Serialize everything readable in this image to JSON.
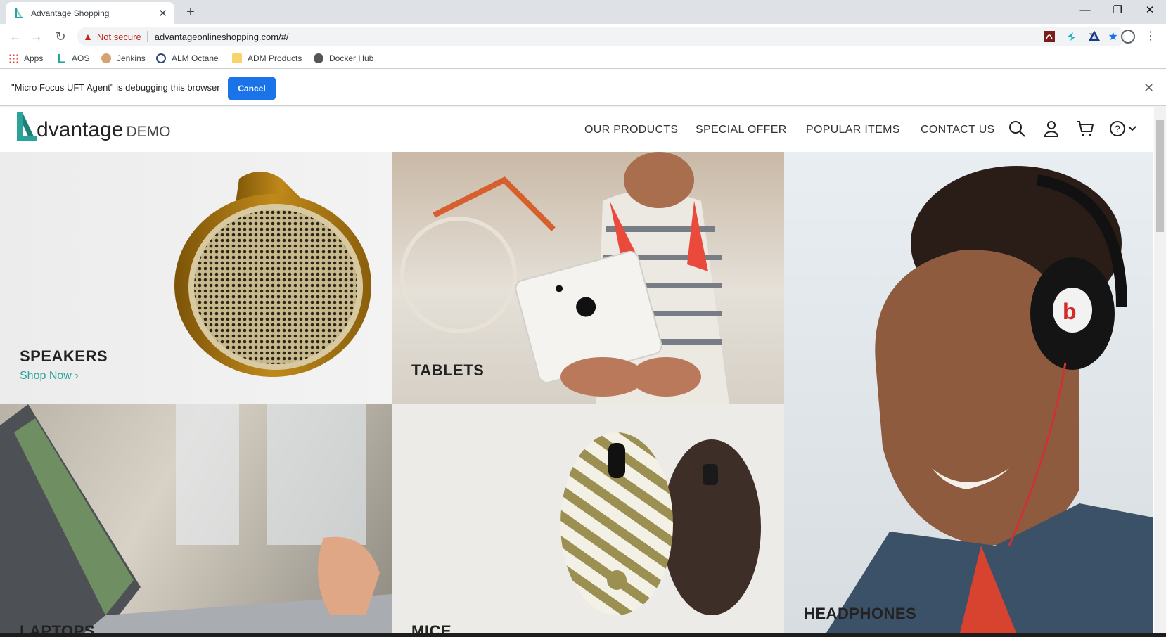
{
  "browser": {
    "tab_title": "Advantage Shopping",
    "url": "advantageonlineshopping.com/#/",
    "security_label": "Not secure",
    "bookmarks": [
      "Apps",
      "AOS",
      "Jenkins",
      "ALM Octane",
      "ADM Products",
      "Docker Hub"
    ],
    "accent": "#1a73e8"
  },
  "infobar": {
    "message": "\"Micro Focus UFT Agent\" is debugging this browser",
    "cancel_label": "Cancel"
  },
  "site": {
    "logo_word": "dvantage",
    "logo_suffix": "DEMO",
    "nav": [
      "OUR PRODUCTS",
      "SPECIAL OFFER",
      "POPULAR ITEMS",
      "CONTACT US"
    ],
    "brand_color": "#2ba39b"
  },
  "categories": {
    "speakers": "SPEAKERS",
    "shop_now": "Shop Now",
    "tablets": "TABLETS",
    "laptops": "LAPTOPS",
    "mice": "MICE",
    "headphones": "HEADPHONES"
  }
}
